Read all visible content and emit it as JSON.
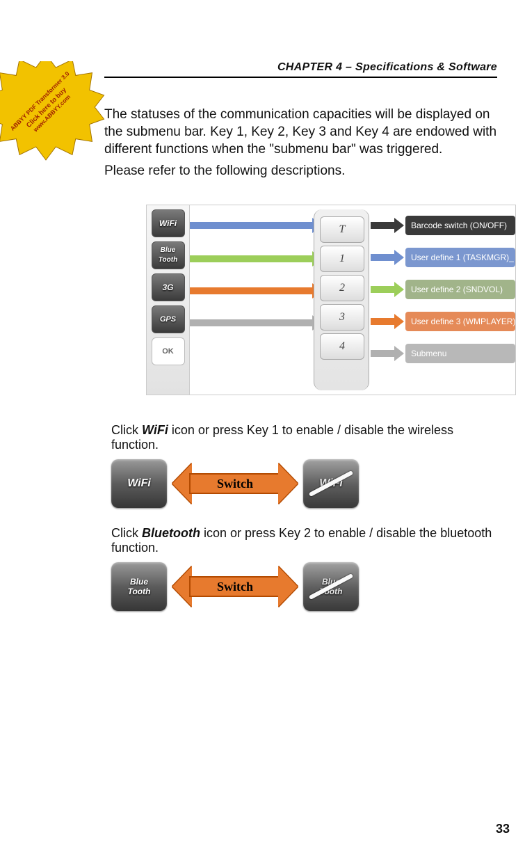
{
  "header": {
    "chapter": "CHAPTER 4 – Specifications & Software"
  },
  "badge": {
    "line1": "ABBYY PDF Transformer 3.0",
    "line2": "Click here to buy",
    "line3": "www.ABBYY.com"
  },
  "intro": {
    "p1": "The statuses of the communication capacities will be displayed on the submenu bar. Key 1, Key 2, Key 3 and Key 4 are endowed with different functions when the \"submenu bar\" was triggered.",
    "p2": "Please refer to the following descriptions."
  },
  "sidebar_icons": {
    "wifi": "WiFi",
    "bluetooth_l1": "Blue",
    "bluetooth_l2": "Tooth",
    "g3": "3G",
    "gps": "GPS",
    "ok": "OK"
  },
  "keypad": {
    "t": "T",
    "k1": "1",
    "k2": "2",
    "k3": "3",
    "k4": "4"
  },
  "diagram_labels": {
    "barcode": "Barcode switch (ON/OFF)",
    "ud1": "User define 1 (TASKMGR)_",
    "ud2": "User define 2 (SNDVOL)",
    "ud3": "User define 3 (WMPLAYER)",
    "submenu": "Submenu"
  },
  "colors": {
    "black": "#3a3a3a",
    "blue": "#6f8fcf",
    "green": "#9cce5a",
    "orange": "#e77a2e",
    "gray": "#b0b0b0"
  },
  "instructions": {
    "wifi_pre": "Click ",
    "wifi_bold": "WiFi",
    "wifi_post": " icon or press Key 1 to enable / disable the wireless function.",
    "bt_pre": "Click ",
    "bt_bold": "Bluetooth",
    "bt_post": " icon or press Key 2 to enable / disable the bluetooth function."
  },
  "switch_label": "Switch",
  "page_number": "33"
}
